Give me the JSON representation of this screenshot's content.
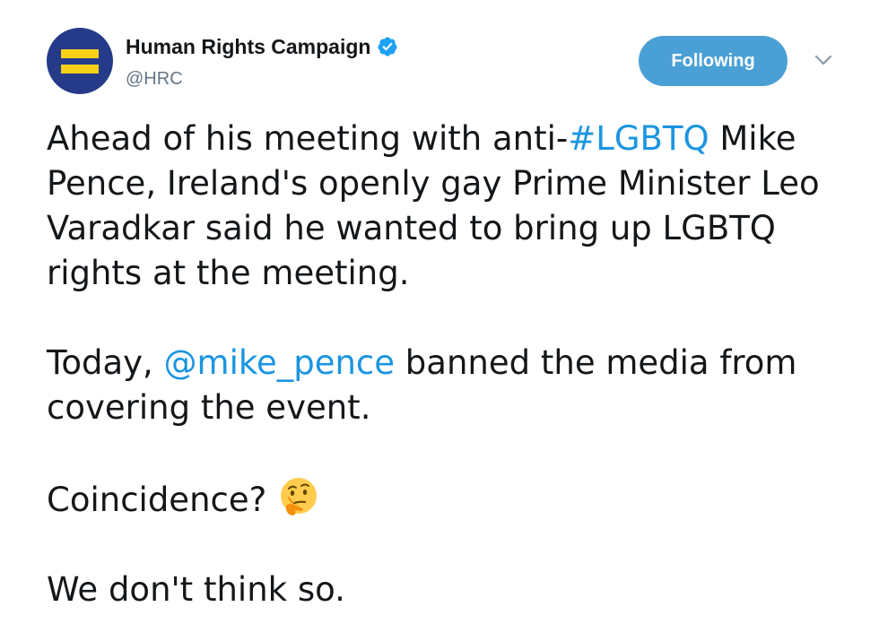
{
  "tweet": {
    "author": {
      "display_name": "Human Rights Campaign",
      "handle": "@HRC",
      "verified": true,
      "avatar_icon": "hrc-equality-logo-icon"
    },
    "follow_button_label": "Following",
    "menu_icon": "chevron-down-icon",
    "paragraphs": {
      "p1_prefix": "Ahead of his meeting with anti-",
      "p1_hashtag": "#LGBTQ",
      "p1_suffix": " Mike Pence, Ireland's openly gay Prime Minister Leo Varadkar said he wanted to bring up LGBTQ rights at the meeting.",
      "p2_prefix": "Today, ",
      "p2_mention": "@mike_pence",
      "p2_suffix": " banned the media from covering the event.",
      "p3_text": "Coincidence?",
      "p3_emoji": "thinking-face-icon",
      "p4_text": "We don't think so."
    }
  },
  "colors": {
    "link": "#1b95e0",
    "button_bg": "#4aa0d5",
    "avatar_bg": "#253b8a",
    "avatar_bars": "#f7d117",
    "handle_text": "#657786"
  }
}
